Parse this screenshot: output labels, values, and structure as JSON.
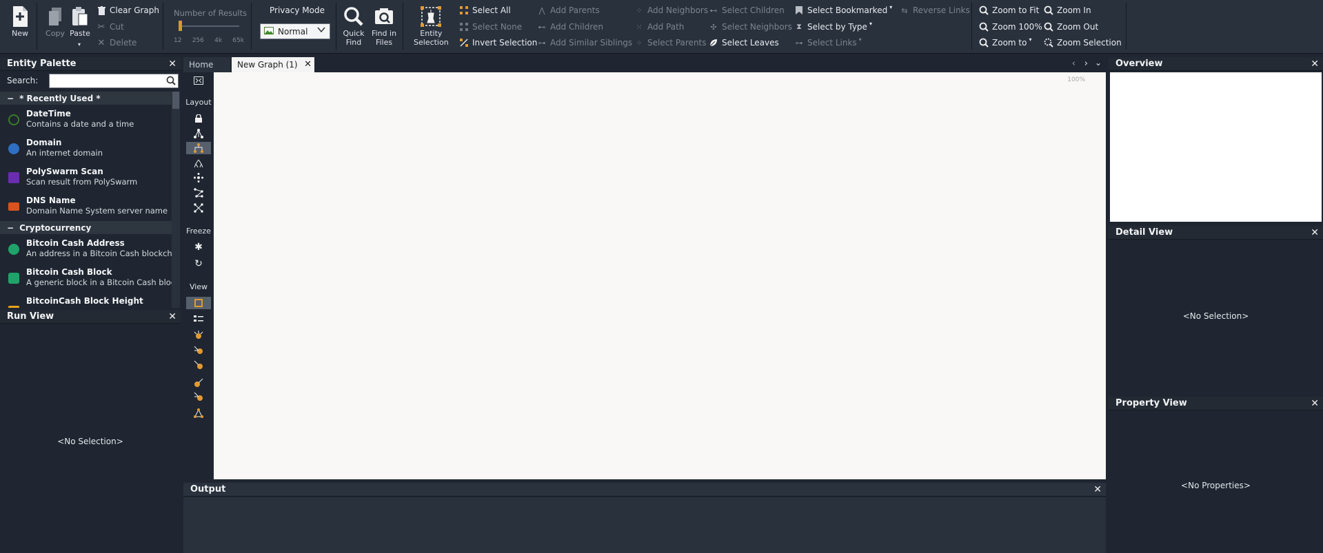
{
  "toolbar": {
    "new_label": "New",
    "copy_label": "Copy",
    "paste_label": "Paste",
    "clear_graph_label": "Clear Graph",
    "cut_label": "Cut",
    "delete_label": "Delete",
    "number_of_results_label": "Number of Results",
    "results_ticks": [
      "12",
      "256",
      "4k",
      "65k"
    ],
    "privacy_mode_label": "Privacy Mode",
    "privacy_mode_value": "Normal",
    "quick_find_label_1": "Quick",
    "quick_find_label_2": "Find",
    "find_in_files_label_1": "Find in",
    "find_in_files_label_2": "Files",
    "entity_selection_label_1": "Entity",
    "entity_selection_label_2": "Selection",
    "select_all": "Select All",
    "select_none": "Select None",
    "invert_selection": "Invert Selection",
    "add_parents": "Add Parents",
    "add_children": "Add Children",
    "add_similar_siblings": "Add Similar Siblings",
    "add_neighbors": "Add Neighbors",
    "add_path": "Add Path",
    "select_parents": "Select Parents",
    "select_children": "Select Children",
    "select_neighbors": "Select Neighbors",
    "select_leaves": "Select Leaves",
    "select_bookmarked": "Select Bookmarked",
    "select_by_type": "Select by Type",
    "select_links": "Select Links",
    "reverse_links": "Reverse Links",
    "zoom_to_fit": "Zoom to Fit",
    "zoom_100": "Zoom 100%",
    "zoom_to": "Zoom to",
    "zoom_in": "Zoom In",
    "zoom_out": "Zoom Out",
    "zoom_selection": "Zoom Selection"
  },
  "palette": {
    "title": "Entity Palette",
    "search_label": "Search:",
    "search_value": "",
    "categories": [
      {
        "name": "* Recently Used *",
        "items": [
          {
            "name": "DateTime",
            "desc": "Contains a date and a time",
            "color": "#3b7a2a"
          },
          {
            "name": "Domain",
            "desc": "An internet domain",
            "color": "#2f6fc2"
          },
          {
            "name": "PolySwarm Scan",
            "desc": "Scan result from PolySwarm",
            "color": "#6a2db0"
          },
          {
            "name": "DNS Name",
            "desc": "Domain Name System server name",
            "color": "#d9531e"
          }
        ]
      },
      {
        "name": "Cryptocurrency",
        "items": [
          {
            "name": "Bitcoin Cash Address",
            "desc": "An address in a Bitcoin Cash blockch",
            "color": "#1fa36a"
          },
          {
            "name": "Bitcoin Cash Block",
            "desc": "A generic block in a Bitcoin Cash bloc",
            "color": "#1fa36a"
          },
          {
            "name": "BitcoinCash Block Height",
            "desc": "",
            "color": "#e8a21a"
          }
        ]
      }
    ]
  },
  "run_view": {
    "title": "Run View",
    "empty": "<No Selection>"
  },
  "tabs": [
    {
      "label": "Home"
    },
    {
      "label": "New Graph (1)"
    }
  ],
  "graph": {
    "zoom_level": "100%",
    "layout_label": "Layout",
    "freeze_label": "Freeze",
    "view_label": "View"
  },
  "output": {
    "title": "Output"
  },
  "overview": {
    "title": "Overview"
  },
  "detail_view": {
    "title": "Detail View",
    "empty": "<No Selection>"
  },
  "property_view": {
    "title": "Property View",
    "empty": "<No Properties>"
  }
}
